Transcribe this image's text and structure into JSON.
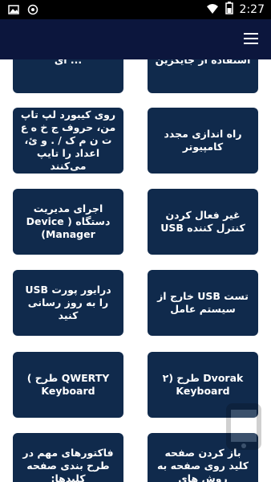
{
  "status_bar": {
    "time": "2:27",
    "icons": [
      "image-icon",
      "shield-icon",
      "wifi-icon",
      "battery-icon"
    ]
  },
  "app_bar": {
    "menu_icon": "hamburger-menu-icon"
  },
  "cards": [
    {
      "text": "... ای",
      "position": "left"
    },
    {
      "text": "استفاده از جایگزین",
      "position": "right"
    },
    {
      "text": "روی کیبورد لپ تاپ من، حروف ج خ ه ع ت ن م ک / . و ئ، اعداد را تایپ می‌کنند",
      "position": "left"
    },
    {
      "text": "راه اندازی مجدد کامپیوتر",
      "position": "right"
    },
    {
      "text": "اجرای مدیریت دستگاه ( Device Manager)",
      "position": "left"
    },
    {
      "text": "غیر فعال کردن کنترل کننده USB",
      "position": "right"
    },
    {
      "text": "درایور پورت USB را به روز رسانی کنید",
      "position": "left"
    },
    {
      "text": "تست USB خارج از سیستم عامل",
      "position": "right"
    },
    {
      "text": "QWERTY طرح ) Keyboard",
      "position": "left"
    },
    {
      "text": "Dvorak طرح (۲ Keyboard",
      "position": "right"
    },
    {
      "text": "فاکتورهای مهم در طرح بندی صفحه کلیدها:",
      "position": "left"
    },
    {
      "text": "باز کردن صفحه کلید روی صفحه به روش های",
      "position": "right"
    }
  ],
  "colors": {
    "app_bar": "#0c163d",
    "card": "#102a4c",
    "text": "#ffffff"
  }
}
